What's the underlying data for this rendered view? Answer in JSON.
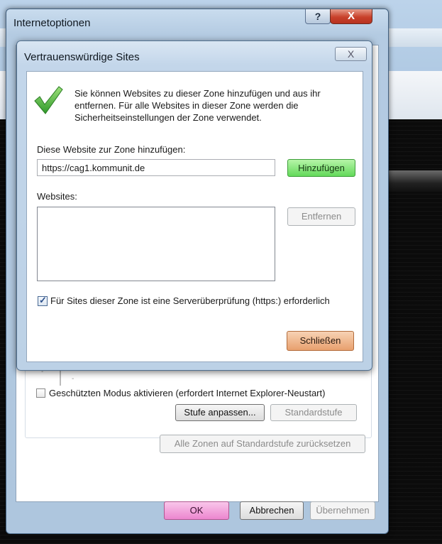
{
  "outer_dialog": {
    "title": "Internetoptionen",
    "help_label": "?",
    "close_label": "X",
    "protected_mode_label": "Geschützten Modus aktivieren (erfordert Internet Explorer-Neustart)",
    "custom_level_label": "Stufe anpassen...",
    "default_level_label": "Standardstufe",
    "reset_all_label": "Alle Zonen auf Standardstufe zurücksetzen",
    "ok_label": "OK",
    "cancel_label": "Abbrechen",
    "apply_label": "Übernehmen"
  },
  "trusted_sites_dialog": {
    "title": "Vertrauenswürdige Sites",
    "close_label": "X",
    "info_text": "Sie können Websites zu dieser Zone hinzufügen und aus ihr entfernen. Für alle Websites in dieser Zone werden die Sicherheitseinstellungen der Zone verwendet.",
    "add_label": "Diese Website zur Zone hinzufügen:",
    "url_value": "https://cag1.kommunit.de",
    "add_button": "Hinzufügen",
    "websites_label": "Websites:",
    "remove_button": "Entfernen",
    "https_checkbox_label": "Für Sites dieser Zone ist eine Serverüberprüfung (https:) erforderlich",
    "https_checked": true,
    "close_button": "Schließen"
  },
  "colors": {
    "add_button": "#63d95a",
    "close_button": "#e8a06e",
    "ok_button": "#f08ad0"
  }
}
